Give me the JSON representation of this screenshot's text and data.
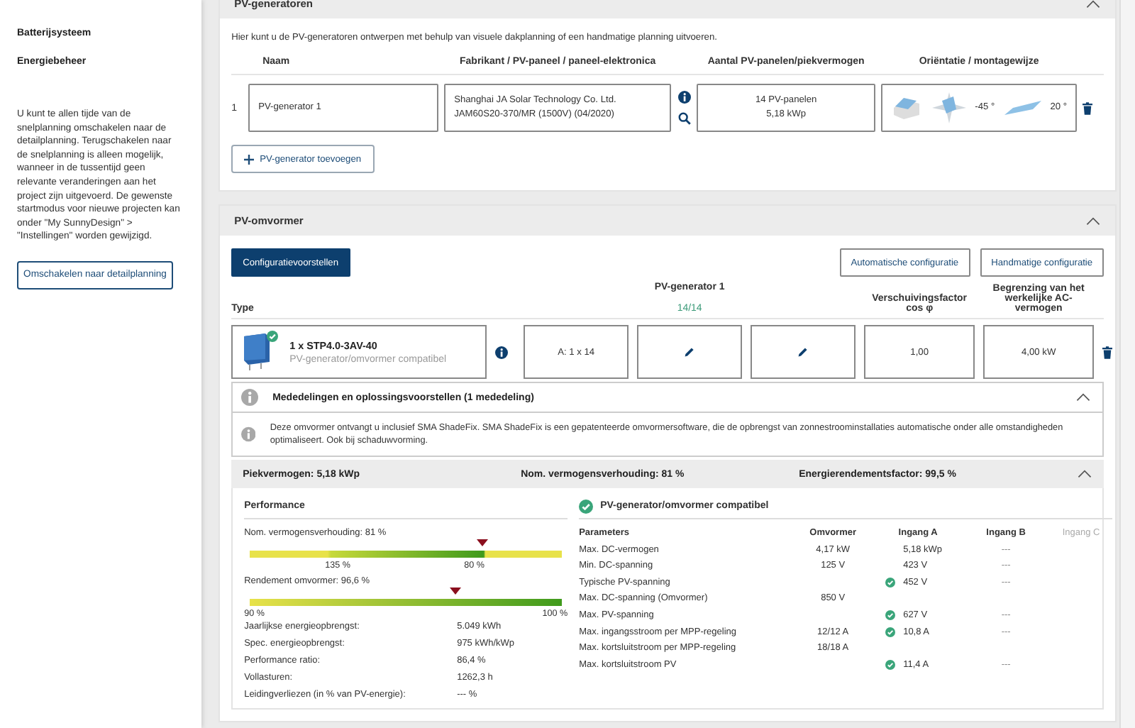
{
  "sidebar": {
    "items": [
      {
        "label": "Batterijsysteem"
      },
      {
        "label": "Energiebeheer"
      }
    ],
    "info": "U kunt te allen tijde van de snelplanning omschakelen naar de detailplanning. Terugschakelen naar de snelplanning is alleen mogelijk, wanneer in de tussentijd geen relevante veranderingen aan het project zijn uitgevoerd. De gewenste startmodus voor nieuwe projecten kan onder \"My SunnyDesign\" > \"Instellingen\" worden gewijzigd.",
    "button": "Omschakelen naar detailplanning"
  },
  "pv_generators": {
    "title": "PV-generatoren",
    "expanded": true,
    "description": "Hier kunt u de PV-generatoren ontwerpen met behulp van visuele dakplanning of een handmatige planning uitvoeren.",
    "columns": [
      "Naam",
      "Fabrikant / PV-paneel / paneel-elektronica",
      "Aantal PV-panelen/piekvermogen",
      "Oriëntatie / montagewijze"
    ],
    "rows": [
      {
        "index": "1",
        "name": "PV-generator 1",
        "manufacturer": [
          "Shanghai JA Solar Technology Co. Ltd.",
          "JAM60S20-370/MR (1500V) (04/2020)"
        ],
        "panels": [
          "14 PV-panelen",
          "5,18 kWp"
        ],
        "azimuth": "-45 °",
        "tilt": "20 °"
      }
    ],
    "add_button": "PV-generator toevoegen"
  },
  "inverter": {
    "title": "PV-omvormer",
    "expanded": true,
    "proposals_button": "Configuratievoorstellen",
    "buttons": [
      "Automatische configuratie",
      "Handmatige configuratie"
    ],
    "type_label": "Type",
    "generator": {
      "title": "PV-generator 1",
      "count": "14/14"
    },
    "headers": [
      "Verschuivingsfactor cos φ",
      "Begrenzing van het werkelijke AC-vermogen"
    ],
    "rows": [
      {
        "model": "1 x STP4.0-3AV-40",
        "status": "PV-generator/omvormer compatibel",
        "ok": true,
        "cells": [
          {
            "kind": "text",
            "text": "A: 1 x 14"
          },
          {
            "kind": "edit"
          },
          {
            "kind": "edit"
          },
          {
            "kind": "text",
            "text": "1,00"
          },
          {
            "kind": "text",
            "text": "4,00 kW"
          }
        ]
      }
    ],
    "notices": {
      "title": "Mededelingen en oplossingsvoorstellen (1 mededeling)",
      "expanded": true,
      "items": [
        "Deze omvormer ontvangt u inclusief SMA ShadeFix. SMA ShadeFix is een gepatenteerde omvormersoftware, die de opbrengst van zonnestroominstallaties automatische onder alle omstandigheden optimaliseert. Ook bij schaduwvorming."
      ]
    },
    "summary": {
      "expanded": true,
      "items": [
        "Piekvermogen: 5,18 kWp",
        "Nom. vermogensverhouding: 81 %",
        "Energierendementsfactor: 99,5 %"
      ]
    },
    "performance": {
      "title": "Performance",
      "gauges": [
        {
          "kind": "ratio",
          "label": "Nom. vermogensverhouding: 81 %",
          "level": 0.745,
          "ticks": [
            "135 %",
            "80 %"
          ]
        },
        {
          "kind": "efficiency",
          "label": "Rendement omvormer: 96,6 %",
          "level": 0.66,
          "ticks": [
            "90 %",
            "100 %"
          ]
        }
      ],
      "stats": [
        {
          "label": "Jaarlijkse energieopbrengst:",
          "value": "5.049 kWh"
        },
        {
          "label": "Spec. energieopbrengst:",
          "value": "975 kWh/kWp"
        },
        {
          "label": "Performance ratio:",
          "value": "86,4 %"
        },
        {
          "label": "Vollasturen:",
          "value": "1262,3 h"
        },
        {
          "label": "Leidingverliezen (in % van PV-energie):",
          "value": "--- %"
        }
      ]
    },
    "compatibility": {
      "title": "PV-generator/omvormer compatibel",
      "ok": true,
      "columns": [
        {
          "label": "Parameters",
          "disabled": false
        },
        {
          "label": "Omvormer",
          "disabled": false
        },
        {
          "label": "Ingang A",
          "disabled": false
        },
        {
          "label": "Ingang B",
          "disabled": false
        },
        {
          "label": "Ingang C",
          "disabled": true
        }
      ],
      "rows": [
        {
          "parameter": "Max. DC-vermogen",
          "inverter": "4,17 kW",
          "input_a": {
            "text": "5,18 kWp",
            "ok": false
          },
          "input_b": "---"
        },
        {
          "parameter": "Min. DC-spanning",
          "inverter": "125 V",
          "input_a": {
            "text": "423 V",
            "ok": false
          },
          "input_b": "---"
        },
        {
          "parameter": "Typische PV-spanning",
          "input_a": {
            "text": "452 V",
            "ok": true
          },
          "input_b": "---"
        },
        {
          "parameter": "Max. DC-spanning (Omvormer)",
          "inverter": "850 V"
        },
        {
          "parameter": "Max. PV-spanning",
          "input_a": {
            "text": "627 V",
            "ok": true
          },
          "input_b": "---"
        },
        {
          "parameter": "Max. ingangsstroom per MPP-regeling",
          "inverter": "12/12 A",
          "input_a": {
            "text": "10,8 A",
            "ok": true
          },
          "input_b": "---"
        },
        {
          "parameter": "Max. kortsluitstroom per MPP-regeling",
          "inverter": "18/18 A"
        },
        {
          "parameter": "Max. kortsluitstroom PV",
          "input_a": {
            "text": "11,4 A",
            "ok": true
          },
          "input_b": "---"
        }
      ]
    }
  }
}
